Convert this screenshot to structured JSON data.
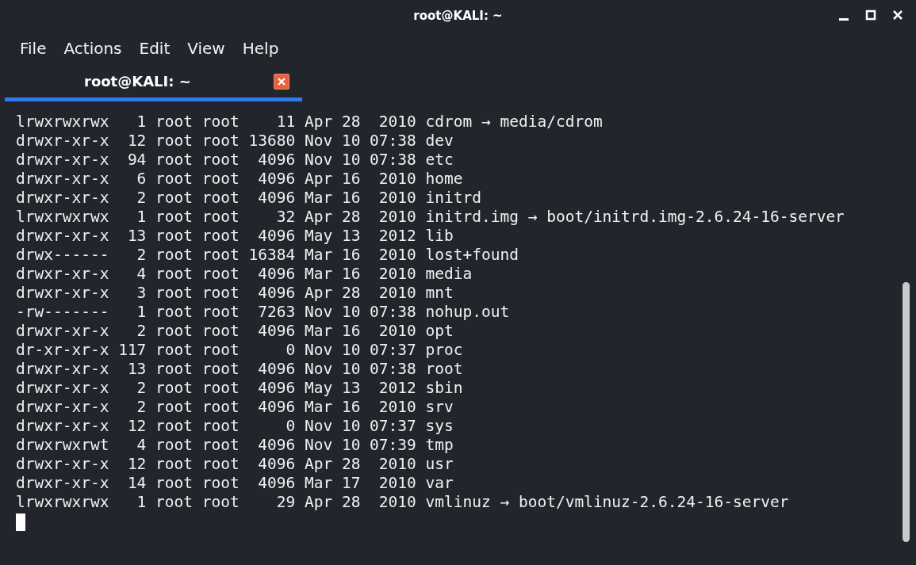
{
  "window": {
    "title": "root@KALI: ~"
  },
  "menu": [
    "File",
    "Actions",
    "Edit",
    "View",
    "Help"
  ],
  "tabs": [
    {
      "label": "root@KALI: ~",
      "selected": true
    }
  ],
  "terminal": {
    "lines": [
      "lrwxrwxrwx   1 root root    11 Apr 28  2010 cdrom → media/cdrom",
      "drwxr-xr-x  12 root root 13680 Nov 10 07:38 dev",
      "drwxr-xr-x  94 root root  4096 Nov 10 07:38 etc",
      "drwxr-xr-x   6 root root  4096 Apr 16  2010 home",
      "drwxr-xr-x   2 root root  4096 Mar 16  2010 initrd",
      "lrwxrwxrwx   1 root root    32 Apr 28  2010 initrd.img → boot/initrd.img-2.6.24-16-server",
      "drwxr-xr-x  13 root root  4096 May 13  2012 lib",
      "drwx------   2 root root 16384 Mar 16  2010 lost+found",
      "drwxr-xr-x   4 root root  4096 Mar 16  2010 media",
      "drwxr-xr-x   3 root root  4096 Apr 28  2010 mnt",
      "-rw-------   1 root root  7263 Nov 10 07:38 nohup.out",
      "drwxr-xr-x   2 root root  4096 Mar 16  2010 opt",
      "dr-xr-xr-x 117 root root     0 Nov 10 07:37 proc",
      "drwxr-xr-x  13 root root  4096 Nov 10 07:38 root",
      "drwxr-xr-x   2 root root  4096 May 13  2012 sbin",
      "drwxr-xr-x   2 root root  4096 Mar 16  2010 srv",
      "drwxr-xr-x  12 root root     0 Nov 10 07:37 sys",
      "drwxrwxrwt   4 root root  4096 Nov 10 07:39 tmp",
      "drwxr-xr-x  12 root root  4096 Apr 28  2010 usr",
      "drwxr-xr-x  14 root root  4096 Mar 17  2010 var",
      "lrwxrwxrwx   1 root root    29 Apr 28  2010 vmlinuz → boot/vmlinuz-2.6.24-16-server"
    ]
  }
}
